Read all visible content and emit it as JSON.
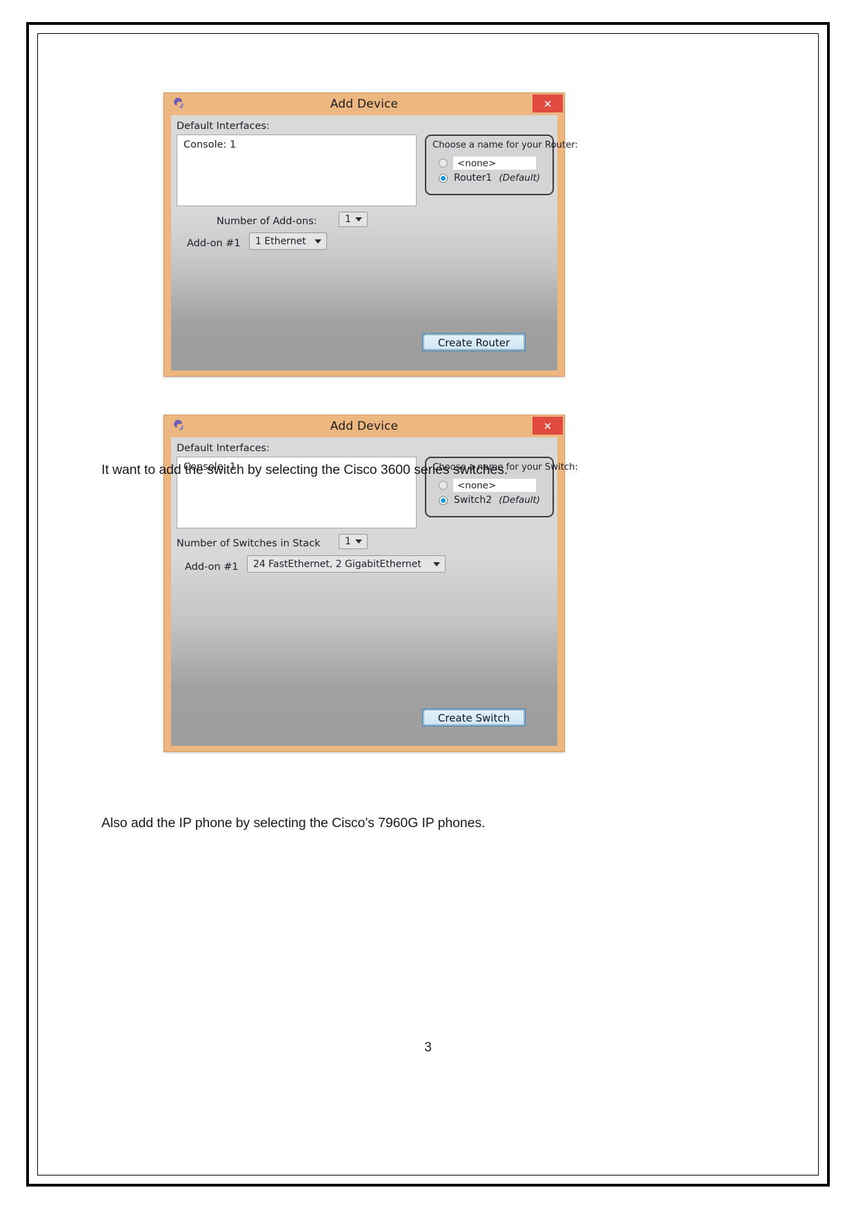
{
  "document": {
    "page_number": "3",
    "paragraphs": [
      "It want to add the switch by selecting the Cisco 3600 series switches.",
      "Also add the IP phone by selecting the Cisco’s 7960G IP phones."
    ]
  },
  "router_dialog": {
    "title": "Add Device",
    "icon": "packet-tracer-logo-icon",
    "close_label": "✕",
    "default_interfaces_label": "Default Interfaces:",
    "interfaces": [
      "Console: 1"
    ],
    "name_group": {
      "title": "Choose a name for your Router:",
      "options": [
        {
          "label": "<none>",
          "type": "input",
          "value": "<none>",
          "placeholder": "<none>",
          "selected": false
        },
        {
          "label": "Router1",
          "type": "static",
          "tag": "(Default)",
          "selected": true
        }
      ]
    },
    "addon_count_label": "Number of Add-ons:",
    "addon_count_value": "1",
    "addon_row_label": "Add-on #1",
    "addon_value": "1 Ethernet",
    "create_button_label": "Create Router"
  },
  "switch_dialog": {
    "title": "Add Device",
    "icon": "packet-tracer-logo-icon",
    "close_label": "✕",
    "default_interfaces_label": "Default Interfaces:",
    "interfaces": [
      "Console: 1"
    ],
    "name_group": {
      "title": "Choose a name for your Switch:",
      "options": [
        {
          "label": "<none>",
          "type": "input",
          "value": "<none>",
          "placeholder": "<none>",
          "selected": false
        },
        {
          "label": "Switch2",
          "type": "static",
          "tag": "(Default)",
          "selected": true
        }
      ]
    },
    "addon_count_label": "Number of Switches in Stack",
    "addon_count_value": "1",
    "addon_row_label": "Add-on #1",
    "addon_value": "24 FastEthernet, 2 GigabitEthernet",
    "create_button_label": "Create Switch"
  },
  "colors": {
    "dialog_frame": "#edb67f",
    "close_button": "#e04a3f",
    "radio_accent": "#1499d4",
    "button_border": "#3c83b4"
  }
}
